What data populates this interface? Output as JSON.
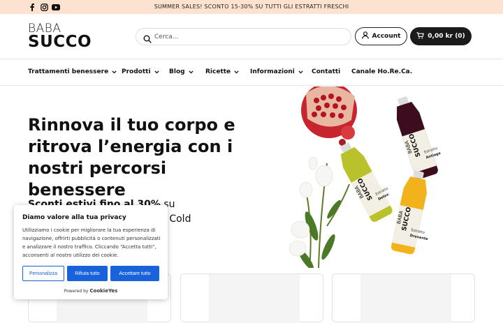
{
  "topbar": {
    "promo": "SUMMER SALES! SCONTO 15-30% SU TUTTI GLI ESTRATTI FRESCHI",
    "social": [
      "facebook-icon",
      "instagram-icon",
      "youtube-icon"
    ],
    "bg_color": "#fde3cf"
  },
  "header": {
    "logo_top": "BABA",
    "logo_bottom": "SUCCO",
    "search_placeholder": "Cerca...",
    "account_label": "Account",
    "cart_label": "0,00 kr (0)"
  },
  "nav": {
    "items": [
      {
        "label": "Trattamenti benessere",
        "dropdown": true
      },
      {
        "label": "Prodotti",
        "dropdown": true
      },
      {
        "label": "Blog",
        "dropdown": true
      },
      {
        "label": "Ricette",
        "dropdown": true
      },
      {
        "label": "Informazioni",
        "dropdown": true
      },
      {
        "label": "Contatti",
        "dropdown": false
      },
      {
        "label": "Canale Ho.Re.Ca.",
        "dropdown": false
      }
    ]
  },
  "hero": {
    "title": "Rinnova il tuo corpo e ritrova l’energia con i nostri percorsi benessere",
    "subtitle_bold": "Sconti estivi fino al 30%",
    "subtitle_rest": " su",
    "subtitle_tail": "i Cold",
    "bottles": [
      {
        "brand_top": "BABA",
        "brand_bottom": "SUCCO",
        "label": "Estratto",
        "name": "Antiage"
      },
      {
        "brand_top": "BABA",
        "brand_bottom": "SUCCO",
        "label": "Estratto",
        "name": "Detox"
      },
      {
        "brand_top": "BABA",
        "brand_bottom": "SUCCO",
        "label": "Estratto",
        "name": "Drenante"
      }
    ]
  },
  "cookie": {
    "title": "Diamo valore alla tua privacy",
    "text": "Utilizziamo i cookie per migliorare la tua esperienza di navigazione, offrirti pubblicità o contenuti personalizzati e analizzare il nostro traffico. Cliccando “Accetta tutti”, acconsenti al nostro utilizzo dei cookie.",
    "btn_customize": "Personalizza",
    "btn_reject": "Rifiuta tutto",
    "btn_accept": "Accettare tutto",
    "powered_prefix": "Powered by",
    "powered_brand": "CookieYes",
    "accent": "#1863dc"
  }
}
